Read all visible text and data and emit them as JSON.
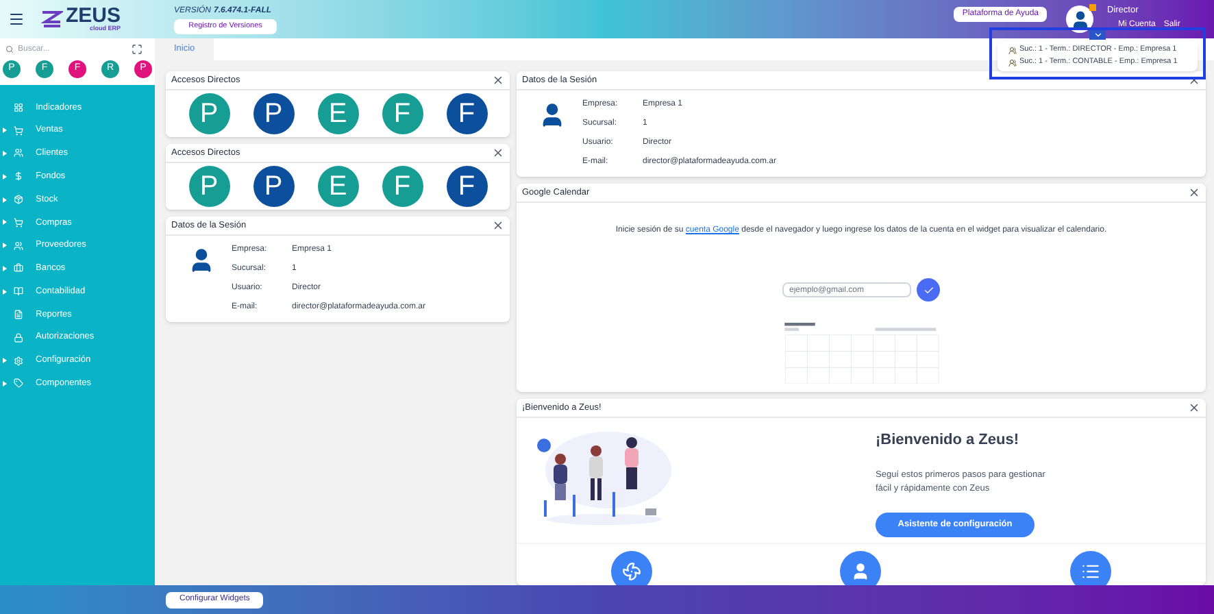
{
  "header": {
    "logo": {
      "name": "ZEUS",
      "tagline": "cloud ERP"
    },
    "version_label": "VERSIÓN",
    "version": "7.6.474.1-FALL",
    "versions_button": "Registro de Versiones",
    "help_button": "Plataforma de Ayuda",
    "user": {
      "name": "Director",
      "account_link": "Mi Cuenta",
      "logout_link": "Salir"
    },
    "terminal_menu": [
      {
        "label": "Suc.: 1 - Term.: DIRECTOR - Emp.: Empresa 1"
      },
      {
        "label": "Suc.: 1 - Term.: CONTABLE - Emp.: Empresa 1"
      }
    ]
  },
  "sidebar": {
    "search": {
      "placeholder": "Buscar..."
    },
    "quick_access": [
      {
        "letter": "P",
        "color": "#169e95"
      },
      {
        "letter": "F",
        "color": "#169e95"
      },
      {
        "letter": "F",
        "color": "#e0127d"
      },
      {
        "letter": "R",
        "color": "#169e95"
      },
      {
        "letter": "P",
        "color": "#e0127d"
      }
    ],
    "items": [
      {
        "label": "Indicadores",
        "kind": "leaf"
      },
      {
        "label": "Ventas",
        "kind": "group"
      },
      {
        "label": "Clientes",
        "kind": "group"
      },
      {
        "label": "Fondos",
        "kind": "group"
      },
      {
        "label": "Stock",
        "kind": "group"
      },
      {
        "label": "Compras",
        "kind": "group"
      },
      {
        "label": "Proveedores",
        "kind": "group"
      },
      {
        "label": "Bancos",
        "kind": "group"
      },
      {
        "label": "Contabilidad",
        "kind": "group"
      },
      {
        "label": "Reportes",
        "kind": "leaf"
      },
      {
        "label": "Autorizaciones",
        "kind": "leaf"
      },
      {
        "label": "Configuración",
        "kind": "group"
      },
      {
        "label": "Componentes",
        "kind": "group"
      }
    ]
  },
  "tabs": [
    {
      "label": "Inicio",
      "selected": true
    }
  ],
  "left_widgets": [
    {
      "kind": "shortcuts",
      "title": "Accesos Directos",
      "items": [
        {
          "letter": "P",
          "color": "#169e95"
        },
        {
          "letter": "P",
          "color": "#0c4f9c"
        },
        {
          "letter": "E",
          "color": "#169e95"
        },
        {
          "letter": "F",
          "color": "#169e95"
        },
        {
          "letter": "F",
          "color": "#0c4f9c"
        }
      ]
    },
    {
      "kind": "shortcuts",
      "title": "Accesos Directos",
      "items": [
        {
          "letter": "P",
          "color": "#169e95"
        },
        {
          "letter": "P",
          "color": "#0c4f9c"
        },
        {
          "letter": "E",
          "color": "#169e95"
        },
        {
          "letter": "F",
          "color": "#169e95"
        },
        {
          "letter": "F",
          "color": "#0c4f9c"
        }
      ]
    },
    {
      "kind": "session",
      "title": "Datos de la Sesión",
      "fields": [
        {
          "label": "Empresa:",
          "value": "Empresa 1"
        },
        {
          "label": "Sucursal:",
          "value": "1"
        },
        {
          "label": "Usuario:",
          "value": "Director"
        },
        {
          "label": "E-mail:",
          "value": "director@plataformadeayuda.com.ar"
        }
      ]
    }
  ],
  "right_widgets": [
    {
      "kind": "session",
      "title": "Datos de la Sesión",
      "fields": [
        {
          "label": "Empresa:",
          "value": "Empresa 1"
        },
        {
          "label": "Sucursal:",
          "value": "1"
        },
        {
          "label": "Usuario:",
          "value": "Director"
        },
        {
          "label": "E-mail:",
          "value": "director@plataformadeayuda.com.ar"
        }
      ]
    },
    {
      "kind": "calendar",
      "title": "Google Calendar",
      "text_before": "Inicie sesión de su",
      "link": "cuenta Google",
      "text_after": "desde el navegador y luego ingrese los datos de la cuenta en el widget para visualizar el calendario.",
      "email_placeholder": "ejemplo@gmail.com"
    },
    {
      "kind": "welcome",
      "title": "¡Bienvenido a Zeus!",
      "heading": "¡Bienvenido a Zeus!",
      "text": "Seguí estos primeros pasos para gestionar fácil y rápidamente con Zeus",
      "button": "Asistente de configuración"
    }
  ],
  "footer": {
    "button": "Configurar Widgets"
  }
}
